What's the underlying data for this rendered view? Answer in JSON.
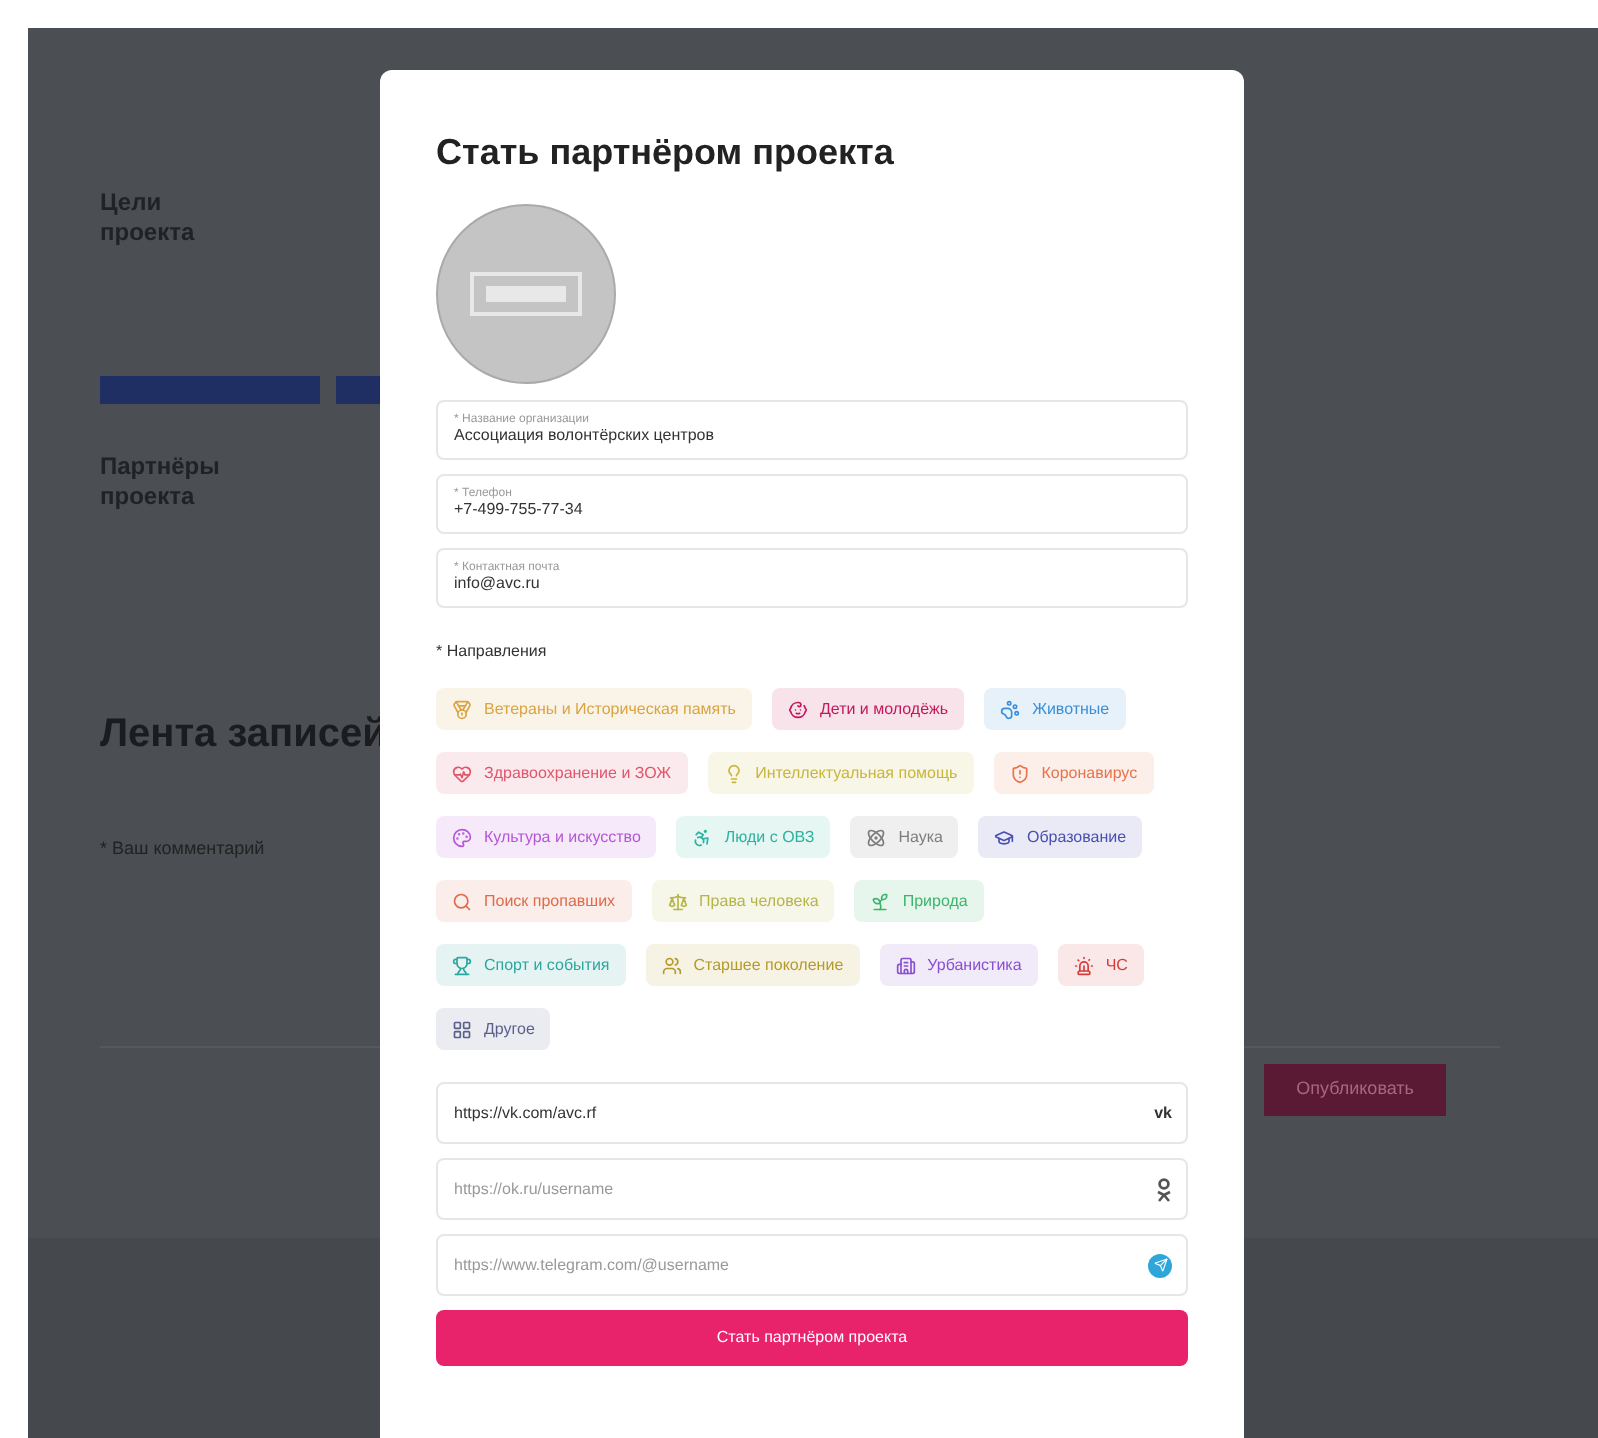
{
  "page": {
    "goals_heading": "Цели проекта",
    "partners_heading": "Партнёры проекта",
    "feed_heading": "Лента записей",
    "comment": {
      "placeholder": "* Ваш комментарий"
    },
    "publish_button": "Опубликовать"
  },
  "modal": {
    "title": "Стать партнёром проекта",
    "fields": [
      {
        "label": "* Название организации",
        "value": "Ассоциация волонтёрских центров"
      },
      {
        "label": "* Телефон",
        "value": "+7-499-755-77-34"
      },
      {
        "label": "* Контактная почта",
        "value": "info@avc.ru"
      }
    ],
    "directions_label": "* Направления",
    "directions": [
      {
        "label": "Ветераны и Историческая память",
        "color": "#d9a441"
      },
      {
        "label": "Дети и молодёжь",
        "color": "#c2185b"
      },
      {
        "label": "Животные",
        "color": "#3b8fd6"
      },
      {
        "label": "Здравоохранение и ЗОЖ",
        "color": "#e0566b"
      },
      {
        "label": "Интеллектуальная помощь",
        "color": "#c9b53a"
      },
      {
        "label": "Коронавирус",
        "color": "#e8734a"
      },
      {
        "label": "Культура и искусство",
        "color": "#b455d6"
      },
      {
        "label": "Люди с ОВЗ",
        "color": "#2bb3a0"
      },
      {
        "label": "Наука",
        "color": "#7d7d7d"
      },
      {
        "label": "Образование",
        "color": "#4a4fb0"
      },
      {
        "label": "Поиск пропавших",
        "color": "#e06a4a"
      },
      {
        "label": "Права человека",
        "color": "#b5b54a"
      },
      {
        "label": "Природа",
        "color": "#3cb56b"
      },
      {
        "label": "Спорт и события",
        "color": "#2ba6a0"
      },
      {
        "label": "Старшее поколение",
        "color": "#b59a2a"
      },
      {
        "label": "Урбанистика",
        "color": "#8a4fd0"
      },
      {
        "label": "ЧС",
        "color": "#d93b3b"
      },
      {
        "label": "Другое",
        "color": "#5a5f8a"
      }
    ],
    "links": [
      {
        "kind": "vk",
        "value": "https://vk.com/avc.rf"
      },
      {
        "kind": "ok",
        "placeholder": "https://ok.ru/username"
      },
      {
        "kind": "telegram",
        "placeholder": "https://www.telegram.com/@username"
      }
    ],
    "submit_button": "Стать партнёром проекта"
  }
}
